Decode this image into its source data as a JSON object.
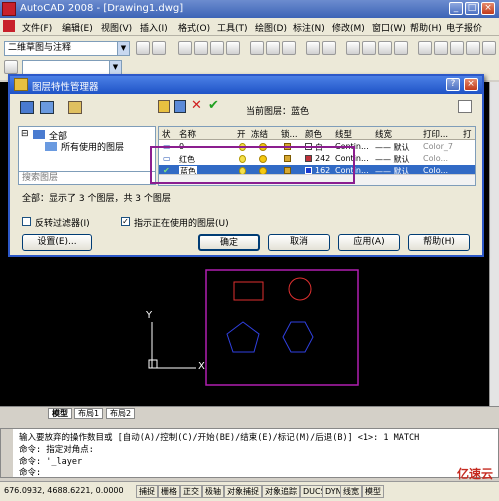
{
  "app": {
    "title": "AutoCAD 2008 - [Drawing1.dwg]"
  },
  "menu": [
    "文件(F)",
    "编辑(E)",
    "视图(V)",
    "插入(I)",
    "格式(O)",
    "工具(T)",
    "绘图(D)",
    "标注(N)",
    "修改(M)",
    "窗口(W)",
    "帮助(H)",
    "电子报价"
  ],
  "toolbar": {
    "workspace": "二维草图与注释"
  },
  "dialog": {
    "title": "图层特性管理器",
    "current_layer_label": "当前图层：蓝色",
    "tree": {
      "root": "全部",
      "child": "所有使用的图层"
    },
    "search_placeholder": "搜索图层",
    "columns": [
      "状",
      "名称",
      "开",
      "冻结",
      "锁...",
      "颜色",
      "线型",
      "线宽",
      "打印...",
      "打"
    ],
    "layers": [
      {
        "name": "0",
        "color_name": "白",
        "color": "#ffffff",
        "linetype": "Contin...",
        "lineweight": "—— 默认",
        "plot_style": "Color_7",
        "selected": false
      },
      {
        "name": "红色",
        "color_name": "242",
        "color": "#c0303a",
        "linetype": "Contin...",
        "lineweight": "—— 默认",
        "plot_style": "Colo...",
        "selected": false
      },
      {
        "name": "蓝色",
        "color_name": "162",
        "color": "#1a3ad0",
        "linetype": "Contin...",
        "lineweight": "—— 默认",
        "plot_style": "Colo...",
        "selected": true
      }
    ],
    "summary": "全部：显示了 3 个图层，共 3 个图层",
    "invert_filter": "反转过滤器(I)",
    "indicate_used": "指示正在使用的图层(U)",
    "buttons": {
      "settings": "设置(E)...",
      "ok": "确定",
      "cancel": "取消",
      "apply": "应用(A)",
      "help": "帮助(H)"
    }
  },
  "tabs": [
    "模型",
    "布局1",
    "布局2"
  ],
  "command": {
    "lines": [
      "输入要放弃的操作数目或 [自动(A)/控制(C)/开始(BE)/结束(E)/标记(M)/后退(B)] <1>: 1 MATCH",
      "命令: 指定对角点:",
      "命令: '_layer",
      "命令:"
    ]
  },
  "status": {
    "coords": "676.0932,  4688.6221, 0.0000",
    "buttons": [
      "捕捉",
      "栅格",
      "正交",
      "极轴",
      "对象捕捉",
      "对象追踪",
      "DUCS",
      "DYN",
      "线宽",
      "模型"
    ]
  },
  "axis": {
    "x": "X",
    "y": "Y"
  },
  "watermark": "亿速云"
}
